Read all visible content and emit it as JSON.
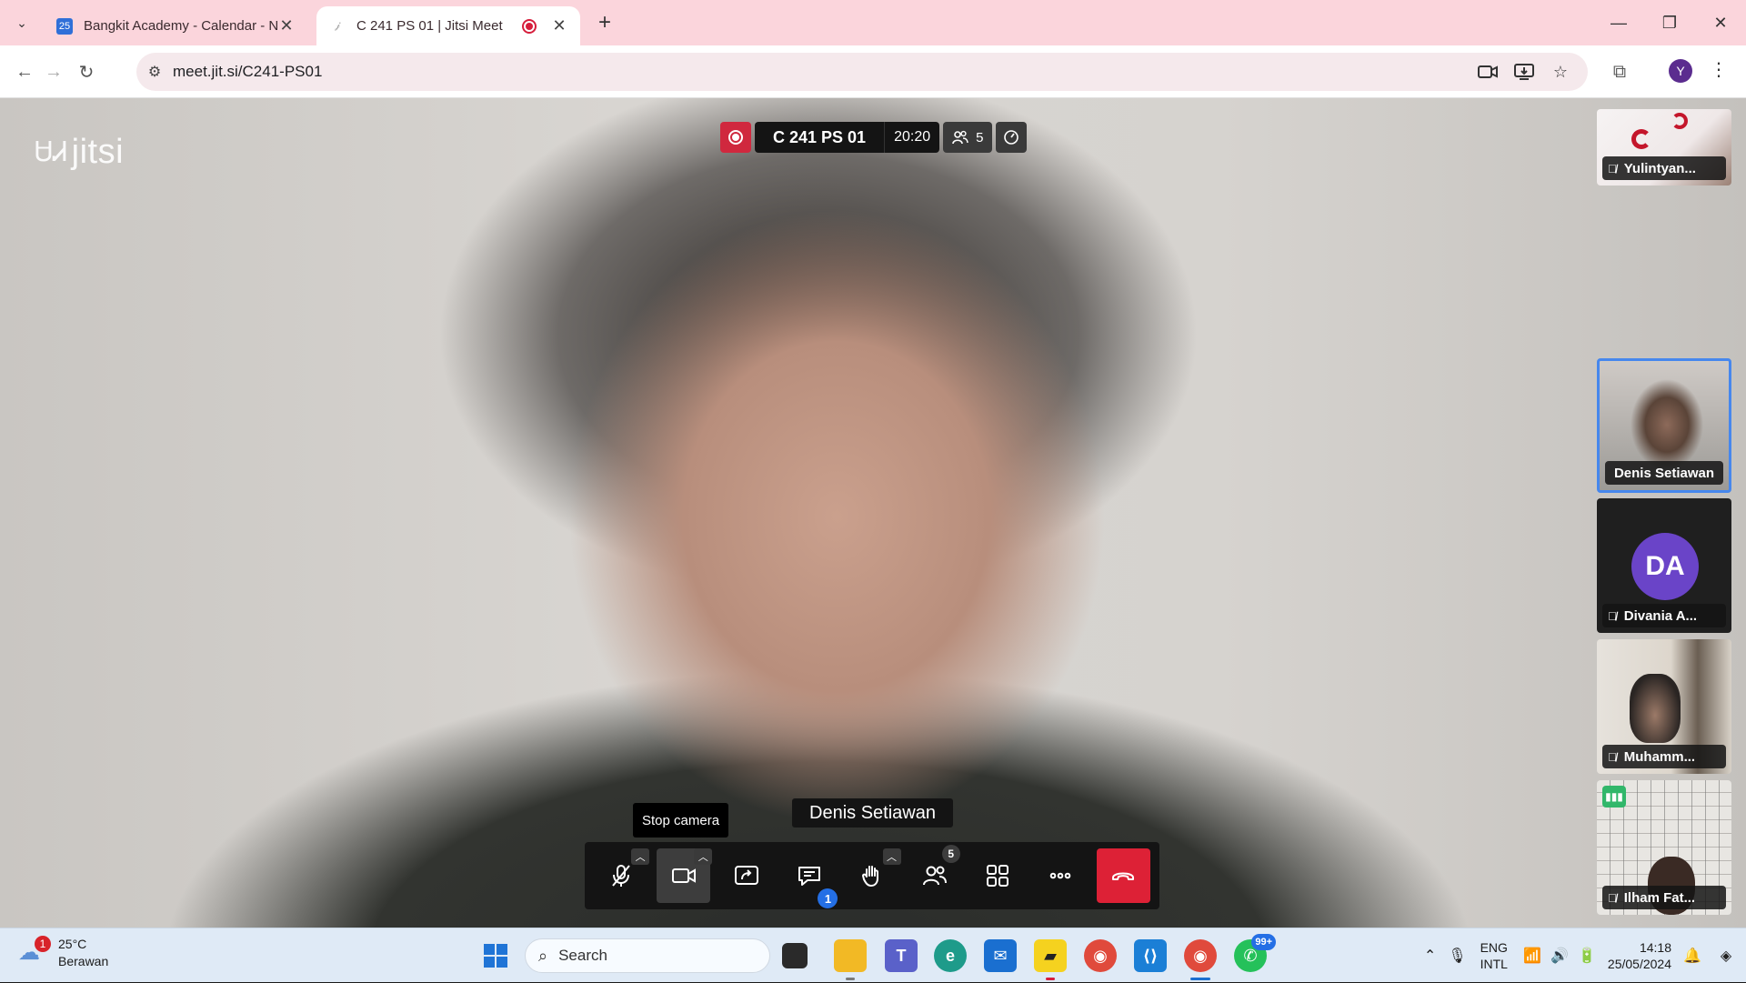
{
  "browser": {
    "tabs": [
      {
        "title": "Bangkit Academy - Calendar - N",
        "favicon_text": "25",
        "active": false
      },
      {
        "title": "C 241 PS 01 | Jitsi Meet",
        "active": true
      }
    ],
    "url": "meet.jit.si/C241-PS01",
    "profile_initial": "Y",
    "new_tab_glyph": "+",
    "close_glyph": "✕"
  },
  "meeting": {
    "logo_text": "jitsi",
    "name": "C 241 PS 01",
    "timer": "20:20",
    "participant_count": "5",
    "speaker_name": "Denis Setiawan",
    "tooltip": "Stop camera",
    "chat_unread": "1",
    "participants_badge": "5"
  },
  "filmstrip": [
    {
      "name": "Yulintyan...",
      "muted": true
    },
    {
      "name": "Denis Setiawan",
      "muted": false,
      "active": true
    },
    {
      "name": "Divania A...",
      "muted": true,
      "avatar": "DA"
    },
    {
      "name": "Muhamm...",
      "muted": true
    },
    {
      "name": "Ilham Fat...",
      "muted": true,
      "speaking": true
    }
  ],
  "taskbar": {
    "weather_temp": "25°C",
    "weather_desc": "Berawan",
    "weather_badge": "1",
    "search_placeholder": "Search",
    "lang_line1": "ENG",
    "lang_line2": "INTL",
    "time": "14:18",
    "date": "25/05/2024",
    "whatsapp_badge": "99+"
  },
  "colors": {
    "tab_bar": "#fbd5dc",
    "record_red": "#d0283e",
    "hangup_red": "#dd2136",
    "badge_blue": "#246fe5",
    "active_border": "#4687ed",
    "avatar_purple": "#6a44c8"
  }
}
